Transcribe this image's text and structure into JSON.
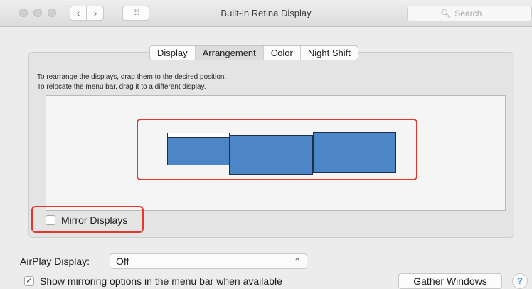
{
  "window": {
    "title": "Built-in Retina Display",
    "back_icon": "‹",
    "forward_icon": "›",
    "grid_icon": "⁞⁞⁞⁞",
    "search_placeholder": "Search"
  },
  "tabs": [
    {
      "label": "Display",
      "active": false
    },
    {
      "label": "Arrangement",
      "active": true
    },
    {
      "label": "Color",
      "active": false
    },
    {
      "label": "Night Shift",
      "active": false
    }
  ],
  "instructions": {
    "line1": "To rearrange the displays, drag them to the desired position.",
    "line2": "To relocate the menu bar, drag it to a different display."
  },
  "displays": [
    {
      "name": "display-1",
      "has_menu_bar": true
    },
    {
      "name": "display-2",
      "has_menu_bar": false
    },
    {
      "name": "display-3",
      "has_menu_bar": false
    }
  ],
  "mirror": {
    "label": "Mirror Displays",
    "checked": false
  },
  "airplay": {
    "label": "AirPlay Display:",
    "value": "Off"
  },
  "show_mirroring": {
    "label": "Show mirroring options in the menu bar when available",
    "checked": true
  },
  "gather_windows": {
    "label": "Gather Windows"
  },
  "help": {
    "label": "?"
  },
  "colors": {
    "display_fill": "#4d86c6",
    "highlight": "#e0392b",
    "background": "#ececec"
  }
}
